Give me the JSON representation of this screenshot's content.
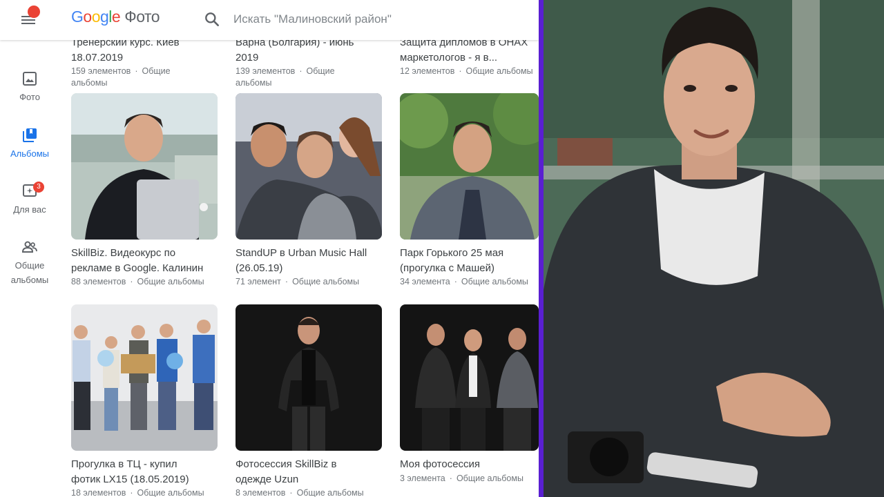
{
  "app": {
    "logo_google": [
      "G",
      "o",
      "o",
      "g",
      "l",
      "e"
    ],
    "logo_product": "Фото",
    "search_placeholder": "Искать \"Малиновский район\""
  },
  "nav": [
    {
      "label": "Фото",
      "icon": "photo-icon",
      "active": false
    },
    {
      "label": "Альбомы",
      "icon": "albums-icon",
      "active": true
    },
    {
      "label": "Для вас",
      "icon": "for-you-icon",
      "badge": "3",
      "active": false
    },
    {
      "label_lines": [
        "Общие",
        "альбомы"
      ],
      "icon": "shared-albums-icon",
      "active": false
    }
  ],
  "albums_partial": [
    {
      "title_lines": [
        "Тренерский курс. Киев",
        "18.07.2019"
      ],
      "count": "159 элементов",
      "shared_lines": [
        "Общие",
        "альбомы"
      ]
    },
    {
      "title_lines": [
        "Варна (Болгария) - июнь",
        "2019"
      ],
      "count": "139 элементов",
      "shared_lines": [
        "Общие",
        "альбомы"
      ]
    },
    {
      "title_lines": [
        "Защита дипломов в OHAX",
        "маркетологов - я в..."
      ],
      "count": "12 элементов",
      "shared": "Общие альбомы"
    }
  ],
  "albums": [
    {
      "title_lines": [
        "SkillBiz. Видеокурс по",
        "рекламе в Google. Калинин"
      ],
      "count": "88 элементов",
      "shared": "Общие альбомы"
    },
    {
      "title_lines": [
        "StandUP в Urban Music Hall",
        "(26.05.19)"
      ],
      "count": "71 элемент",
      "shared": "Общие альбомы"
    },
    {
      "title_lines": [
        "Парк Горького 25 мая",
        "(прогулка с Машей)"
      ],
      "count": "34 элемента",
      "shared": "Общие альбомы"
    },
    {
      "title_lines": [
        "Прогулка в ТЦ - купил",
        "фотик LX15 (18.05.2019)"
      ],
      "count": "18 элементов",
      "shared": "Общие альбомы"
    },
    {
      "title_lines": [
        "Фотосессия SkillBiz в",
        "одежде Uzun"
      ],
      "count": "8 элементов",
      "shared": "Общие альбомы"
    },
    {
      "title_lines": [
        "Моя фотосессия"
      ],
      "count": "3 элемента",
      "shared": "Общие альбомы"
    }
  ],
  "colors": {
    "accent": "#1a73e8",
    "divider": "#5a1fd1",
    "badge": "#ea4335"
  }
}
